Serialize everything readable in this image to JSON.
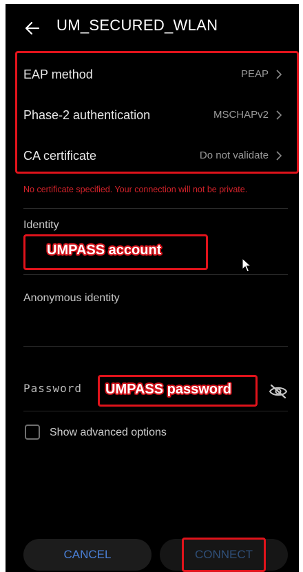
{
  "header": {
    "back_icon": "arrow-left-icon",
    "title": "UM_SECURED_WLAN"
  },
  "settings": [
    {
      "label": "EAP method",
      "value": "PEAP"
    },
    {
      "label": "Phase-2 authentication",
      "value": "MSCHAPv2"
    },
    {
      "label": "CA certificate",
      "value": "Do not validate"
    }
  ],
  "warning": "No certificate specified. Your connection will not be private.",
  "identity": {
    "label": "Identity",
    "value": "UMPASS account"
  },
  "anonymous_identity": {
    "label": "Anonymous identity",
    "value": ""
  },
  "password": {
    "label": "Password",
    "value": "UMPASS password",
    "toggle_icon": "eye-off-icon"
  },
  "advanced": {
    "label": "Show advanced options",
    "checked": false
  },
  "buttons": {
    "cancel": "CANCEL",
    "connect": "CONNECT"
  },
  "colors": {
    "annotation_red": "#e0131b",
    "accent_blue": "#4a7fd6",
    "background": "#000000"
  }
}
